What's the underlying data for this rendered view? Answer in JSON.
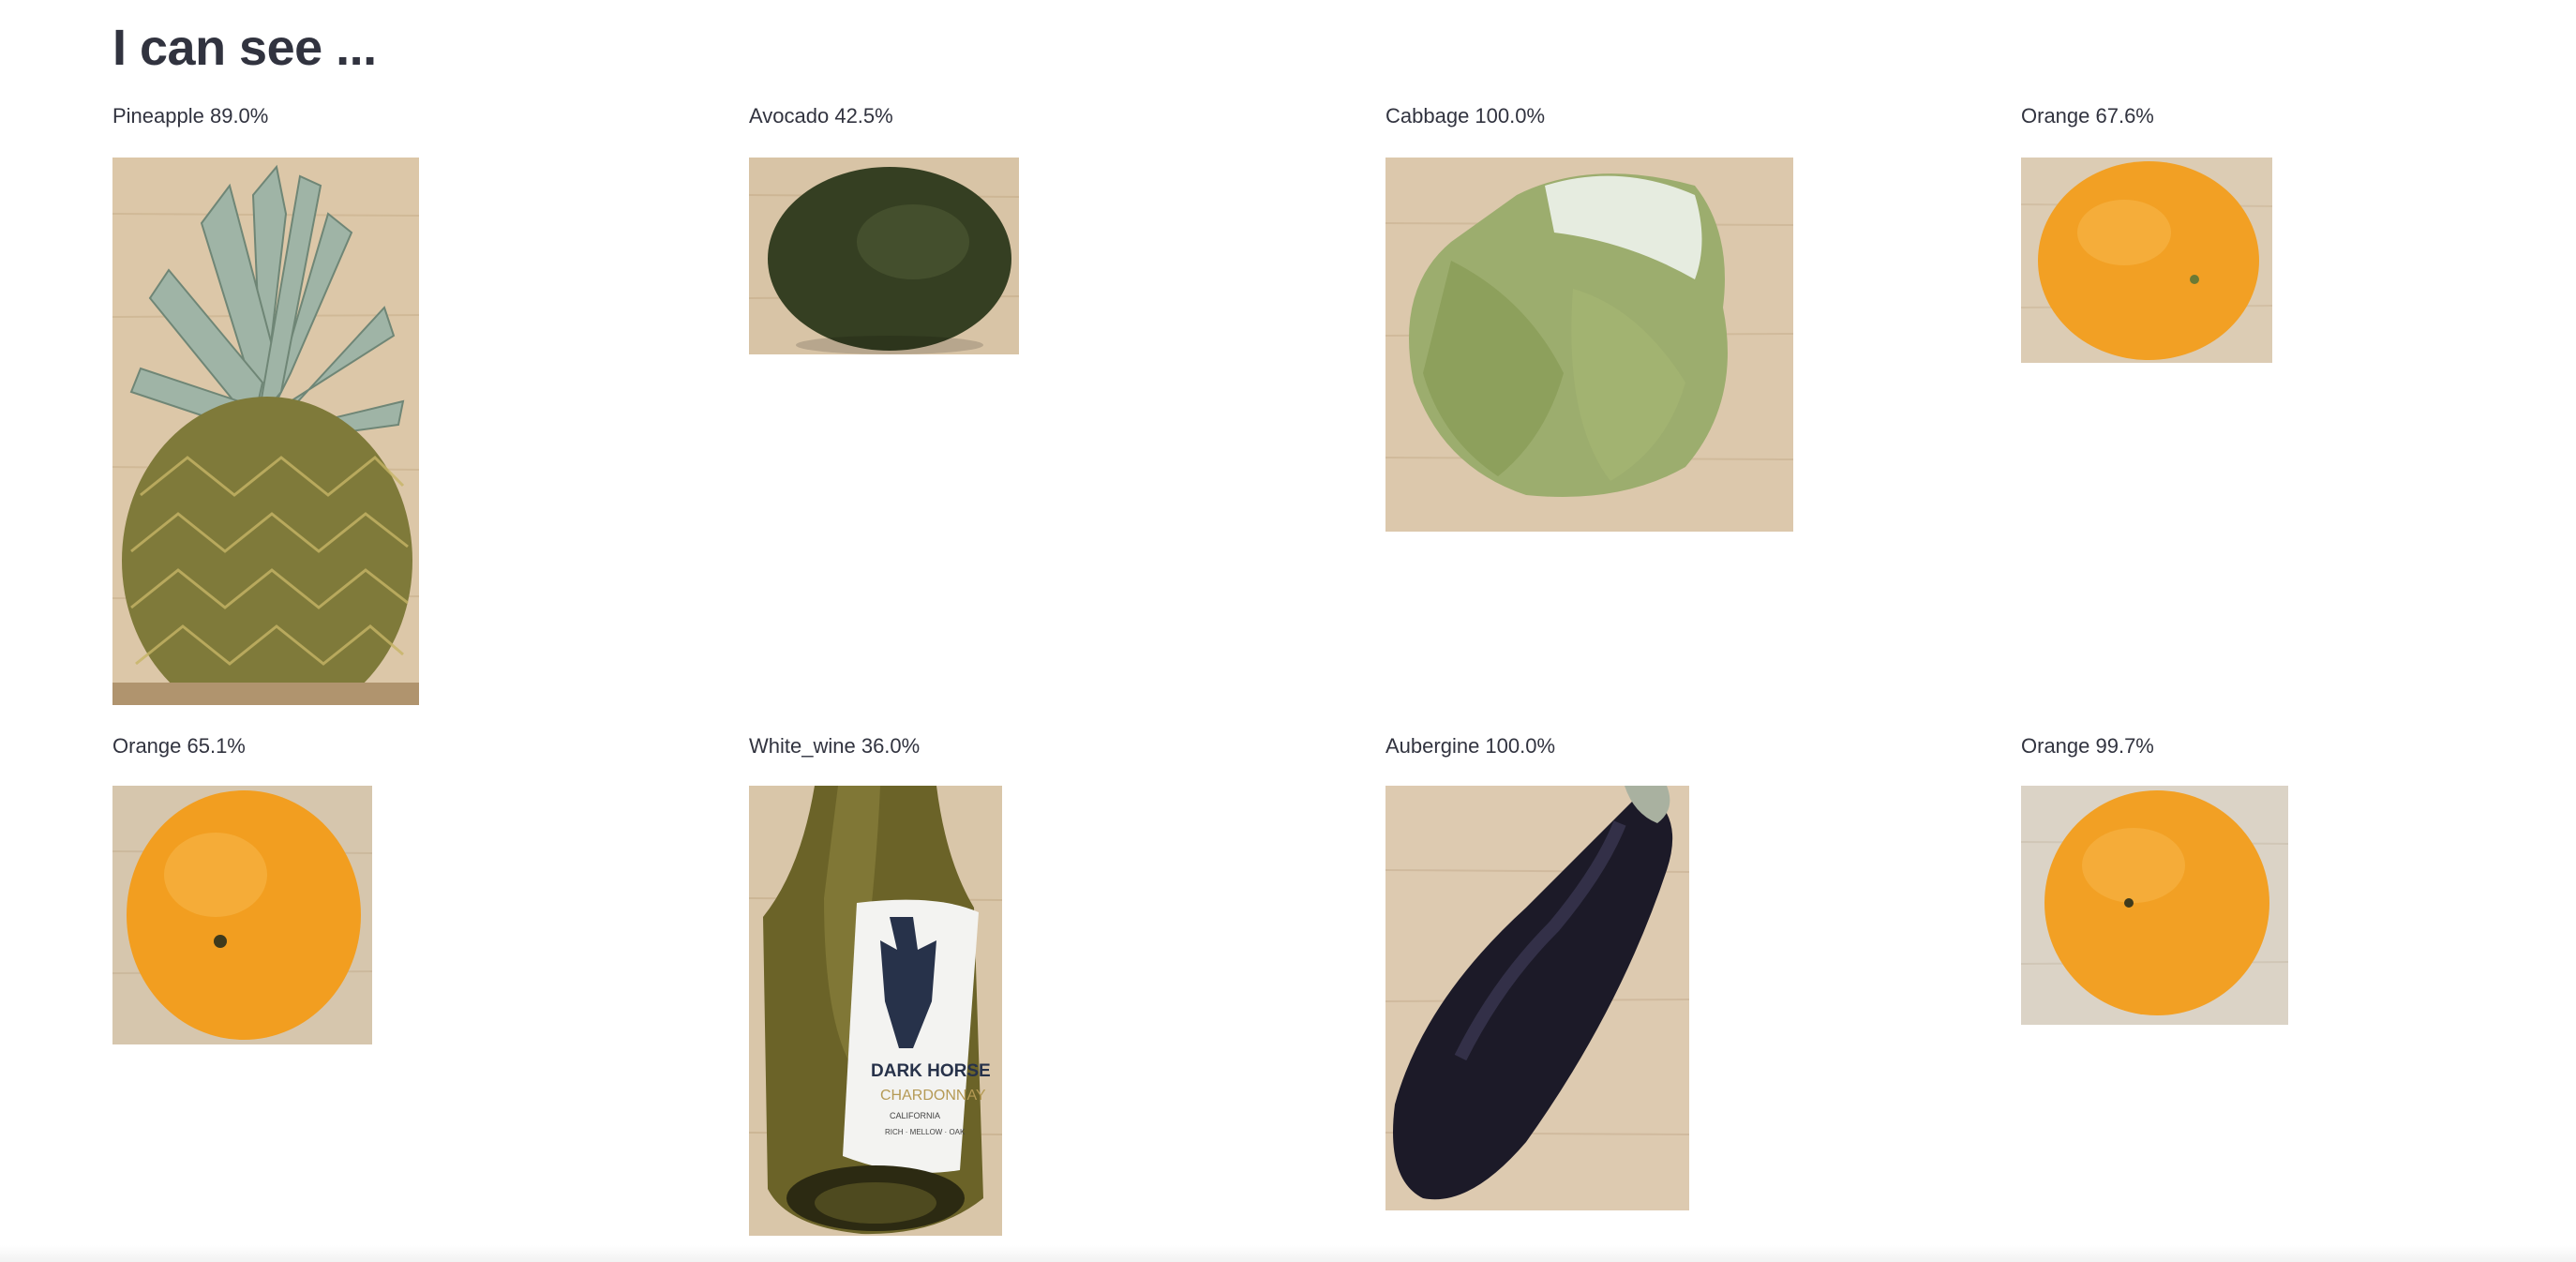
{
  "header": {
    "title": "I can see ..."
  },
  "results": [
    {
      "label": "Pineapple 89.0%",
      "subject": "pineapple-image"
    },
    {
      "label": "Avocado 42.5%",
      "subject": "avocado-image"
    },
    {
      "label": "Cabbage 100.0%",
      "subject": "cabbage-image"
    },
    {
      "label": "Orange 67.6%",
      "subject": "orange-image"
    },
    {
      "label": "Orange 65.1%",
      "subject": "orange-image"
    },
    {
      "label": "White_wine 36.0%",
      "subject": "white-wine-bottle-image"
    },
    {
      "label": "Aubergine 100.0%",
      "subject": "aubergine-image"
    },
    {
      "label": "Orange 99.7%",
      "subject": "orange-image"
    }
  ],
  "wine_label": {
    "brand": "DARK HORSE",
    "variety": "CHARDONNAY",
    "region": "CALIFORNIA",
    "notes": "RICH · MELLOW · OAK"
  },
  "colors": {
    "text": "#31333f",
    "wood_table": "#d9c3a5",
    "orange": "#f2a024"
  }
}
